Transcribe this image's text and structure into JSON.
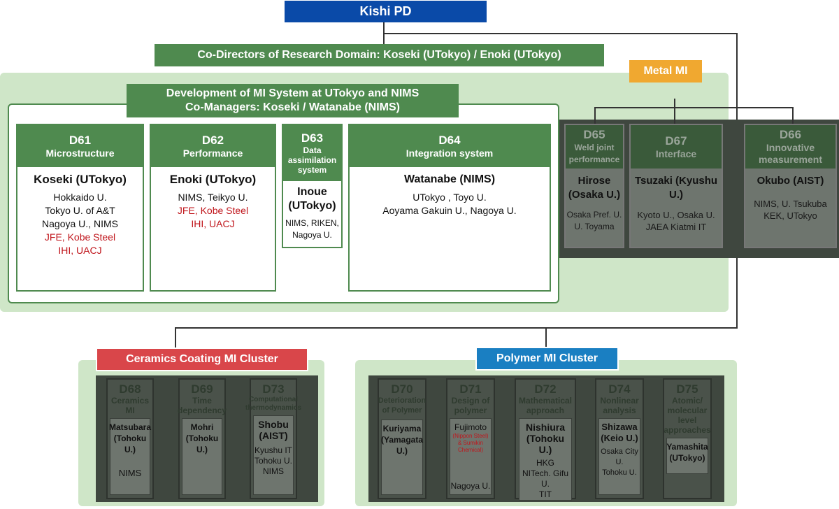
{
  "top": {
    "pd": "Kishi PD",
    "co_directors": "Co-Directors of Research Domain: Koseki (UTokyo) / Enoki (UTokyo)",
    "metal_label": "Metal MI",
    "dev_line1": "Development of MI System at UTokyo and NIMS",
    "dev_line2": "Co-Managers: Koseki / Watanabe (NIMS)"
  },
  "metal": [
    {
      "code": "D61",
      "title": "Microstructure",
      "lead": "Koseki (UTokyo)",
      "lines": [
        "Hokkaido U.",
        "Tokyo U. of A&T",
        "Nagoya U., NIMS"
      ],
      "red": [
        "JFE, Kobe Steel",
        "IHI, UACJ"
      ]
    },
    {
      "code": "D62",
      "title": "Performance",
      "lead": "Enoki (UTokyo)",
      "lines": [
        "NIMS, Teikyo U."
      ],
      "red": [
        "JFE, Kobe Steel",
        "IHI, UACJ"
      ]
    },
    {
      "code": "D63",
      "title": "Data assimilation system",
      "lead": "Inoue (UTokyo)",
      "lines": [
        "NIMS, RIKEN,",
        "Nagoya U."
      ],
      "red": []
    },
    {
      "code": "D64",
      "title": "Integration system",
      "lead": "Watanabe (NIMS)",
      "lines": [
        "UTokyo , Toyo U.",
        "Aoyama Gakuin U., Nagoya U."
      ],
      "red": []
    }
  ],
  "metal_dim": [
    {
      "code": "D65",
      "title": "Weld joint performance",
      "lead": "Hirose (Osaka U.)",
      "lines": [
        "Osaka Pref. U.",
        "U. Toyama"
      ]
    },
    {
      "code": "D67",
      "title": "Interface",
      "lead": "Tsuzaki (Kyushu U.)",
      "lines": [
        "Kyoto U., Osaka U.",
        "JAEA Kiatmi IT"
      ]
    },
    {
      "code": "D66",
      "title": "Innovative measurement",
      "lead": "Okubo (AIST)",
      "lines": [
        "NIMS, U. Tsukuba",
        "KEK, UTokyo"
      ]
    }
  ],
  "ceramics": {
    "label": "Ceramics Coating MI Cluster",
    "cards": [
      {
        "code": "D68",
        "title": "Ceramics MI",
        "lead": "Matsubara (Tohoku U.)",
        "lines": [
          "NIMS"
        ]
      },
      {
        "code": "D69",
        "title": "Time dependency",
        "lead": "Mohri (Tohoku U.)",
        "lines": []
      },
      {
        "code": "D73",
        "title": "Computational thermodynamics",
        "lead": "Shobu (AIST)",
        "lines": [
          "Kyushu IT",
          "Tohoku U.",
          "NIMS"
        ]
      }
    ]
  },
  "polymer": {
    "label": "Polymer MI Cluster",
    "cards": [
      {
        "code": "D70",
        "title": "Deterioration of Polymer",
        "lead": "Kuriyama (Yamagata U.)",
        "lines": []
      },
      {
        "code": "D71",
        "title": "Design of polymer",
        "lead": "Fujimoto",
        "sub": "(Nippon Steel) & Sumikin Chemical)",
        "lines": [
          "Nagoya U."
        ]
      },
      {
        "code": "D72",
        "title": "Mathematical approach",
        "lead": "Nishiura (Tohoku U.)",
        "lines": [
          "HKG",
          "NITech. Gifu U.",
          "TIT"
        ]
      },
      {
        "code": "D74",
        "title": "Nonlinear analysis",
        "lead": "Shizawa (Keio U.)",
        "lines": [
          "Osaka City U.",
          "Tohoku U."
        ]
      },
      {
        "code": "D75",
        "title": "Atomic/ molecular level approaches",
        "lead": "Yamashita (UTokyo)",
        "lines": []
      }
    ]
  },
  "colors": {
    "green": "#4f8a4f",
    "blue": "#0a4aa8",
    "orange": "#f0a830",
    "red": "#d9464a",
    "teal": "#1a7fc2",
    "bg": "#cfe6c8"
  }
}
